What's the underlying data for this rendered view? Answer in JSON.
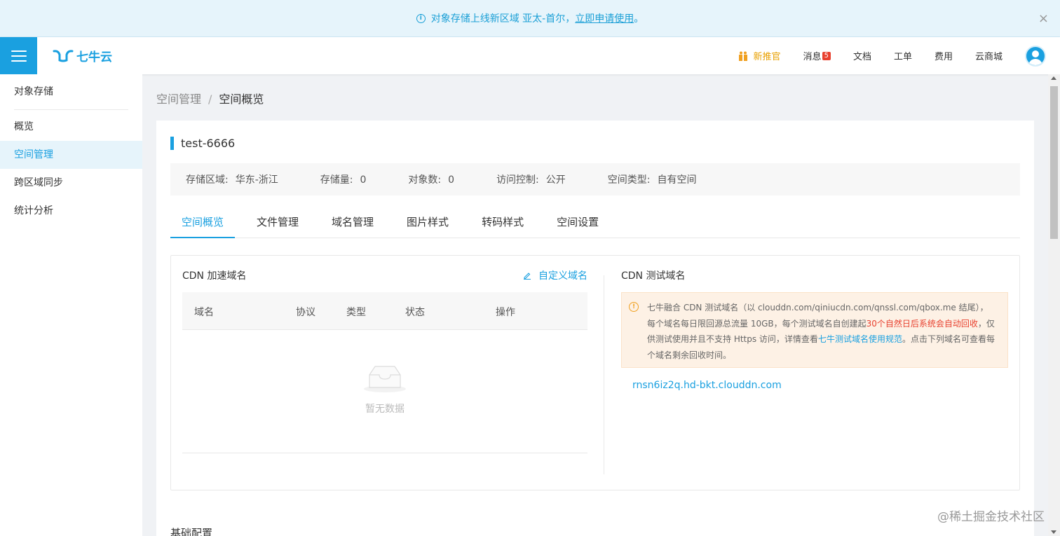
{
  "notice": {
    "text": "对象存储上线新区域 亚太-首尔，",
    "link": "立即申请使用",
    "suffix": "。"
  },
  "header": {
    "logo_text": "七牛云",
    "nav": {
      "gift": "新推官",
      "messages": "消息",
      "messages_count": "5",
      "docs": "文档",
      "tickets": "工单",
      "billing": "费用",
      "market": "云商城"
    }
  },
  "sidebar": {
    "title": "对象存储",
    "items": [
      {
        "label": "概览"
      },
      {
        "label": "空间管理"
      },
      {
        "label": "跨区域同步"
      },
      {
        "label": "统计分析"
      }
    ]
  },
  "breadcrumb": {
    "parent": "空间管理",
    "sep": "/",
    "current": "空间概览"
  },
  "bucket": {
    "name": "test-6666",
    "info": [
      {
        "label": "存储区域:",
        "value": "华东-浙江"
      },
      {
        "label": "存储量:",
        "value": "0"
      },
      {
        "label": "对象数:",
        "value": "0"
      },
      {
        "label": "访问控制:",
        "value": "公开"
      },
      {
        "label": "空间类型:",
        "value": "自有空间"
      }
    ]
  },
  "tabs": [
    {
      "label": "空间概览"
    },
    {
      "label": "文件管理"
    },
    {
      "label": "域名管理"
    },
    {
      "label": "图片样式"
    },
    {
      "label": "转码样式"
    },
    {
      "label": "空间设置"
    }
  ],
  "cdn": {
    "title": "CDN 加速域名",
    "custom_label": "自定义域名",
    "columns": [
      "域名",
      "协议",
      "类型",
      "状态",
      "操作"
    ],
    "empty_text": "暂无数据"
  },
  "test_domain": {
    "title": "CDN 测试域名",
    "notice_part1": "七牛融合 CDN 测试域名（以 clouddn.com/qiniucdn.com/qnssl.com/qbox.me 结尾），每个域名每日限回源总流量 10GB，每个测试域名自创建起",
    "notice_red": "30个自然日后系统会自动回收",
    "notice_part2": "，仅供测试使用并且不支持 Https 访问，详情查看",
    "notice_link": "七牛测试域名使用规范",
    "notice_part3": "。点击下列域名可查看每个域名剩余回收时间。",
    "domain": "rnsn6iz2q.hd-bkt.clouddn.com"
  },
  "base_config": {
    "title": "基础配置"
  },
  "watermark": "@稀土掘金技术社区",
  "colors": {
    "accent": "#1aa0e0",
    "warning_bg": "#fdf1e5",
    "danger": "#e8412f"
  }
}
